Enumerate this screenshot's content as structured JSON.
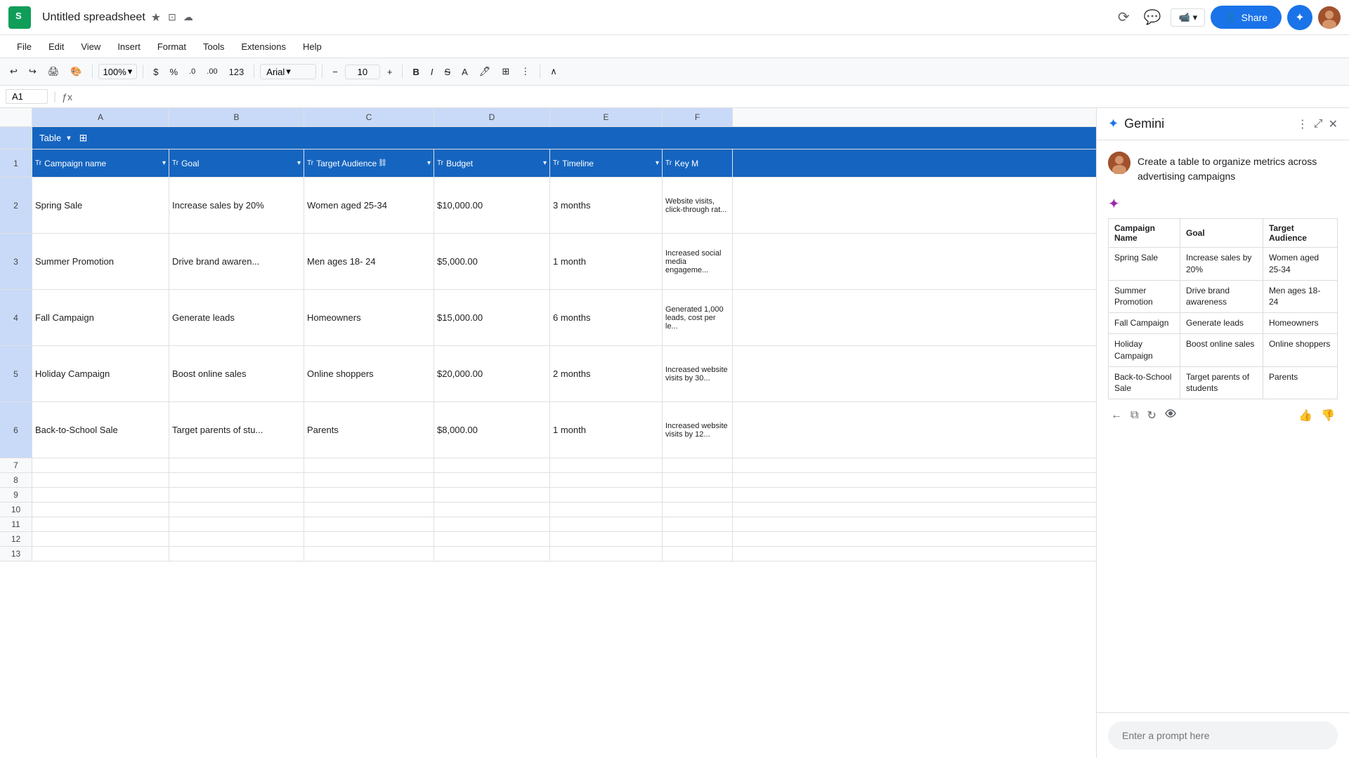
{
  "app": {
    "logo": "G",
    "title": "Untitled spreadsheet",
    "title_icons": [
      "★",
      "☁",
      "⊙"
    ]
  },
  "menu": {
    "items": [
      "File",
      "Edit",
      "View",
      "Insert",
      "Format",
      "Tools",
      "Extensions",
      "Help"
    ]
  },
  "toolbar": {
    "zoom": "100%",
    "font": "Arial",
    "font_size": "10",
    "currency_symbol": "$",
    "percent": "%",
    "decimal_decrease": ".0",
    "decimal_increase": ".00",
    "format_type": "123"
  },
  "formula_bar": {
    "cell_ref": "A1"
  },
  "spreadsheet": {
    "columns": [
      "A",
      "B",
      "C",
      "D",
      "E",
      "F"
    ],
    "table_name": "Table",
    "headers": [
      {
        "icon": "Tr",
        "label": "Campaign name",
        "has_dropdown": true
      },
      {
        "icon": "Tr",
        "label": "Goal",
        "has_dropdown": true
      },
      {
        "icon": "Tr",
        "label": "Target Audience",
        "has_dropdown": true
      },
      {
        "icon": "budget",
        "label": "Budget",
        "has_dropdown": true
      },
      {
        "icon": "Tr",
        "label": "Timeline",
        "has_dropdown": true
      },
      {
        "icon": "Tr",
        "label": "Key M"
      }
    ],
    "rows": [
      {
        "num": 2,
        "cells": [
          "Spring Sale",
          "Increase sales by 20%",
          "Women aged 25-34",
          "$10,000.00",
          "3 months",
          "Website visits, click-through rat..."
        ]
      },
      {
        "num": 3,
        "cells": [
          "Summer Promotion",
          "Drive brand awaren...",
          "Men ages 18- 24",
          "$5,000.00",
          "1 month",
          "Increased social media engageme..."
        ]
      },
      {
        "num": 4,
        "cells": [
          "Fall Campaign",
          "Generate leads",
          "Homeowners",
          "$15,000.00",
          "6 months",
          "Generated 1,000 leads, cost per le..."
        ]
      },
      {
        "num": 5,
        "cells": [
          "Holiday Campaign",
          "Boost online sales",
          "Online shoppers",
          "$20,000.00",
          "2 months",
          "Increased website visits by 30..."
        ]
      },
      {
        "num": 6,
        "cells": [
          "Back-to-School Sale",
          "Target parents of stu...",
          "Parents",
          "$8,000.00",
          "1 month",
          "Increased website visits by 12..."
        ]
      },
      {
        "num": 7,
        "cells": [
          "",
          "",
          "",
          "",
          "",
          ""
        ]
      },
      {
        "num": 8,
        "cells": [
          "",
          "",
          "",
          "",
          "",
          ""
        ]
      },
      {
        "num": 9,
        "cells": [
          "",
          "",
          "",
          "",
          "",
          ""
        ]
      },
      {
        "num": 10,
        "cells": [
          "",
          "",
          "",
          "",
          "",
          ""
        ]
      },
      {
        "num": 11,
        "cells": [
          "",
          "",
          "",
          "",
          "",
          ""
        ]
      },
      {
        "num": 12,
        "cells": [
          "",
          "",
          "",
          "",
          "",
          ""
        ]
      },
      {
        "num": 13,
        "cells": [
          "",
          "",
          "",
          "",
          "",
          ""
        ]
      }
    ]
  },
  "gemini": {
    "title": "Gemini",
    "user_prompt": "Create a table to organize metrics across advertising campaigns",
    "table_preview": {
      "headers": [
        "Campaign Name",
        "Goal",
        "Target Audience"
      ],
      "rows": [
        [
          "Spring Sale",
          "Increase sales by 20%",
          "Women aged 25-34"
        ],
        [
          "Summer Promotion",
          "Drive brand awareness",
          "Men ages 18- 24"
        ],
        [
          "Fall Campaign",
          "Generate leads",
          "Homeowners"
        ],
        [
          "Holiday Campaign",
          "Boost online sales",
          "Online shoppers"
        ],
        [
          "Back-to-School Sale",
          "Target parents of students",
          "Parents"
        ]
      ]
    },
    "input_placeholder": "Enter a prompt here",
    "action_icons": {
      "back": "←",
      "copy": "⧉",
      "refresh": "↻",
      "eye": "👁",
      "thumbs_up": "👍",
      "thumbs_down": "👎"
    }
  },
  "colors": {
    "table_header_bg": "#1565c0",
    "table_header_text": "#ffffff",
    "gemini_blue": "#1a73e8",
    "gemini_purple": "#9c27b0",
    "toolbar_bg": "#f8f9fa",
    "selected_col_bg": "#c9daf8"
  }
}
